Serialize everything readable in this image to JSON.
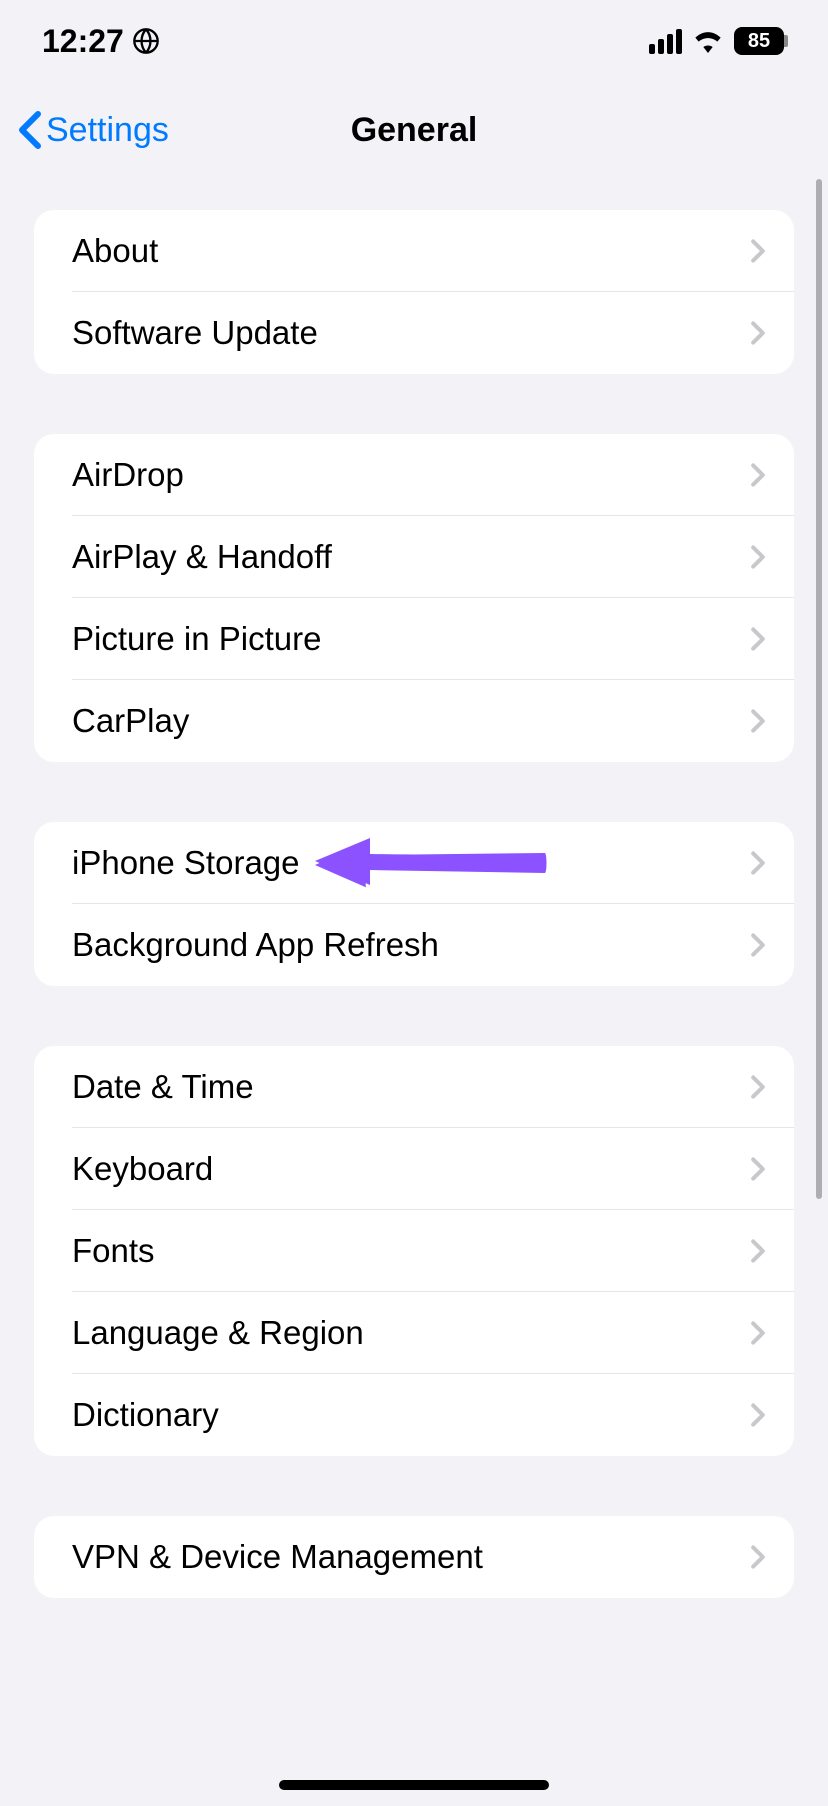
{
  "statusBar": {
    "time": "12:27",
    "battery": "85"
  },
  "nav": {
    "back": "Settings",
    "title": "General"
  },
  "groups": [
    {
      "items": [
        {
          "id": "about",
          "label": "About"
        },
        {
          "id": "software-update",
          "label": "Software Update"
        }
      ]
    },
    {
      "items": [
        {
          "id": "airdrop",
          "label": "AirDrop"
        },
        {
          "id": "airplay-handoff",
          "label": "AirPlay & Handoff"
        },
        {
          "id": "picture-in-picture",
          "label": "Picture in Picture"
        },
        {
          "id": "carplay",
          "label": "CarPlay"
        }
      ]
    },
    {
      "items": [
        {
          "id": "iphone-storage",
          "label": "iPhone Storage"
        },
        {
          "id": "background-app-refresh",
          "label": "Background App Refresh"
        }
      ]
    },
    {
      "items": [
        {
          "id": "date-time",
          "label": "Date & Time"
        },
        {
          "id": "keyboard",
          "label": "Keyboard"
        },
        {
          "id": "fonts",
          "label": "Fonts"
        },
        {
          "id": "language-region",
          "label": "Language & Region"
        },
        {
          "id": "dictionary",
          "label": "Dictionary"
        }
      ]
    },
    {
      "items": [
        {
          "id": "vpn-device-management",
          "label": "VPN & Device Management"
        }
      ]
    }
  ],
  "annotation": {
    "target": "iphone-storage",
    "color": "#8c52ff"
  }
}
